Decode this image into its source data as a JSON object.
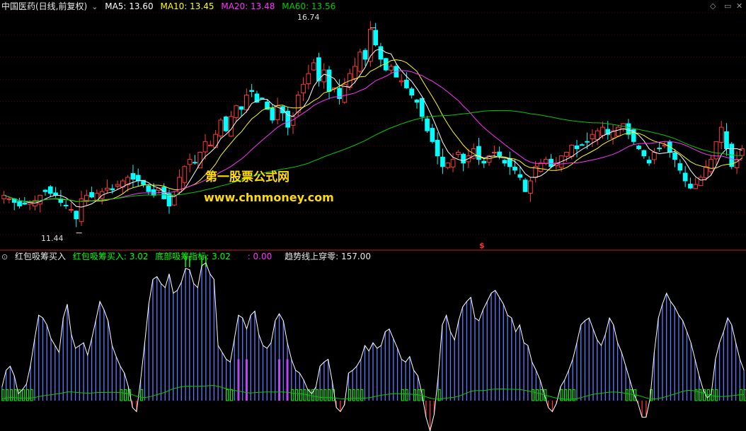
{
  "main_header": {
    "symbol": "中国医药(日线,前复权)",
    "ma5": "MA5: 13.60",
    "ma10": "MA10: 13.45",
    "ma20": "MA20: 13.48",
    "ma60": "MA60: 13.56"
  },
  "sub_header": {
    "name": "红包吸筹买入",
    "buy": "红包吸筹买入: 3.02",
    "bottom": "底部吸筹指标: 3.02",
    "zero": ": 0.00",
    "trend": "趋势线上穿零: 157.00"
  },
  "watermark": {
    "line1": "第一股票公式网",
    "line2": "www.chnmoney.com"
  },
  "price_annotations": {
    "high": "16.74",
    "low": "11.44",
    "signal": "$"
  },
  "colors": {
    "up": "#ff3a3a",
    "down": "#00ffff",
    "ma5": "#ffffff",
    "ma10": "#ffff00",
    "ma20": "#ff33ff",
    "ma60": "#00cc00",
    "bar": "#6677ff",
    "envelope": "#ffffff",
    "green_bar": "#00ff00",
    "red_bar": "#ff3030",
    "purple_bar": "#bb44ff",
    "header_red": "#ff4040"
  },
  "chart_data": [
    {
      "type": "candlestick",
      "title": "中国医药(日线,前复权)",
      "ylim": [
        11.0,
        17.2
      ],
      "series": [
        {
          "name": "MA5"
        },
        {
          "name": "MA10"
        },
        {
          "name": "MA20"
        },
        {
          "name": "MA60"
        }
      ],
      "close": [
        12.1,
        12.0,
        11.9,
        11.8,
        11.85,
        11.9,
        11.95,
        12.1,
        12.2,
        12.15,
        12.1,
        11.9,
        11.8,
        11.7,
        11.44,
        12.0,
        12.1,
        12.05,
        12.15,
        12.2,
        12.3,
        12.25,
        12.4,
        12.5,
        12.6,
        12.55,
        12.5,
        12.4,
        12.2,
        12.1,
        12.3,
        12.0,
        11.8,
        12.1,
        12.6,
        12.9,
        13.1,
        13.0,
        13.3,
        13.6,
        13.5,
        13.8,
        14.2,
        13.9,
        14.3,
        14.6,
        14.5,
        14.9,
        15.0,
        14.7,
        14.8,
        14.5,
        14.2,
        14.6,
        14.4,
        14.0,
        14.3,
        14.9,
        15.2,
        15.5,
        15.8,
        15.3,
        15.6,
        15.0,
        15.1,
        14.8,
        15.2,
        15.5,
        15.7,
        16.1,
        15.9,
        16.74,
        16.3,
        15.9,
        15.6,
        15.7,
        15.4,
        15.3,
        15.1,
        14.9,
        14.7,
        14.3,
        13.9,
        13.6,
        13.2,
        12.9,
        13.0,
        13.1,
        13.3,
        13.0,
        13.2,
        13.4,
        13.1,
        13.0,
        13.2,
        13.3,
        13.2,
        13.0,
        12.9,
        12.8,
        12.6,
        12.2,
        12.5,
        12.9,
        13.0,
        13.1,
        12.9,
        13.0,
        13.2,
        13.3,
        13.5,
        13.4,
        13.5,
        13.6,
        13.8,
        13.9,
        14.0,
        13.8,
        13.9,
        14.0,
        14.1,
        13.8,
        13.6,
        13.4,
        13.2,
        13.0,
        13.3,
        13.4,
        13.5,
        13.3,
        13.1,
        12.8,
        12.5,
        12.3,
        12.4,
        12.6,
        12.9,
        13.1,
        13.6,
        14.0,
        13.4,
        12.9,
        13.1,
        13.4
      ]
    },
    {
      "type": "bar",
      "title": "红包吸筹买入",
      "ylim": [
        -20,
        100
      ],
      "values": [
        10,
        22,
        25,
        18,
        5,
        8,
        12,
        26,
        45,
        62,
        60,
        55,
        45,
        40,
        35,
        60,
        70,
        48,
        38,
        40,
        42,
        33,
        45,
        58,
        72,
        66,
        58,
        40,
        32,
        25,
        20,
        10,
        -5,
        -8,
        15,
        42,
        70,
        88,
        90,
        85,
        82,
        92,
        78,
        80,
        86,
        96,
        95,
        85,
        82,
        98,
        100,
        92,
        88,
        40,
        35,
        30,
        28,
        45,
        62,
        60,
        52,
        62,
        65,
        48,
        40,
        38,
        42,
        58,
        63,
        58,
        42,
        30,
        22,
        20,
        15,
        8,
        5,
        10,
        25,
        28,
        30,
        14,
        -5,
        -8,
        -3,
        20,
        22,
        25,
        30,
        40,
        36,
        42,
        38,
        40,
        50,
        52,
        45,
        38,
        30,
        28,
        32,
        22,
        18,
        5,
        -12,
        -22,
        -10,
        18,
        55,
        62,
        50,
        44,
        58,
        68,
        72,
        75,
        60,
        58,
        66,
        72,
        78,
        80,
        75,
        70,
        62,
        60,
        50,
        55,
        42,
        40,
        28,
        22,
        15,
        5,
        -5,
        -8,
        -2,
        10,
        15,
        22,
        30,
        42,
        55,
        58,
        60,
        52,
        44,
        40,
        48,
        60,
        55,
        42,
        35,
        25,
        15,
        5,
        -2,
        -12,
        -12,
        2,
        35,
        60,
        70,
        78,
        72,
        68,
        62,
        58,
        50,
        42,
        30,
        18,
        8,
        2,
        5,
        30,
        42,
        50,
        60,
        55,
        42,
        30,
        22
      ]
    }
  ]
}
